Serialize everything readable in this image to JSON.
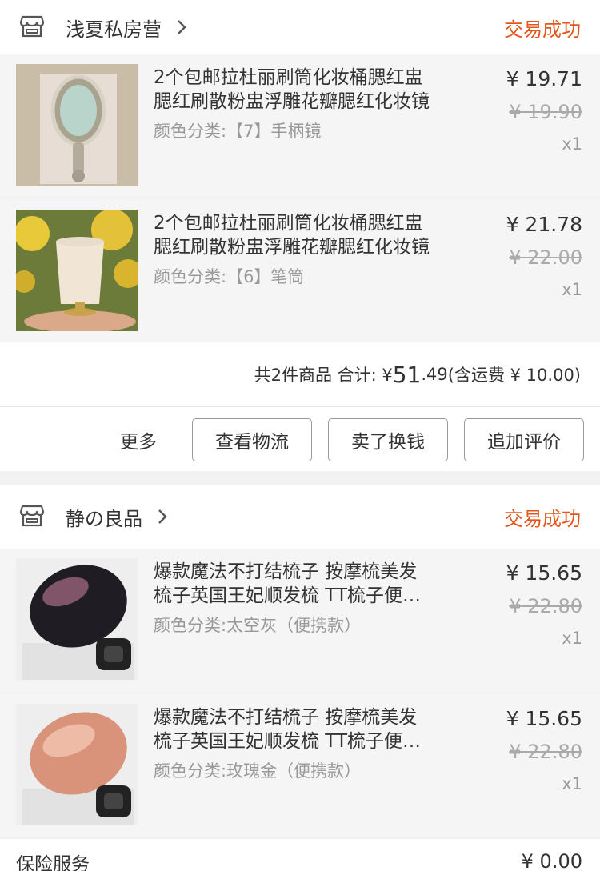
{
  "orders": [
    {
      "shop_name": "浅夏私房营",
      "status": "交易成功",
      "items": [
        {
          "title_line1": "2个包邮拉杜丽刷筒化妆桶腮红盅",
          "title_line2": "腮红刷散粉盅浮雕花瓣腮红化妆镜",
          "spec": "颜色分类:【7】手柄镜",
          "price": "¥ 19.71",
          "original_price": "¥ 19.90",
          "qty": "x1"
        },
        {
          "title_line1": "2个包邮拉杜丽刷筒化妆桶腮红盅",
          "title_line2": "腮红刷散粉盅浮雕花瓣腮红化妆镜",
          "spec": "颜色分类:【6】笔筒",
          "price": "¥ 21.78",
          "original_price": "¥ 22.00",
          "qty": "x1"
        }
      ],
      "summary": {
        "count_text": "共2件商品 合计: ¥ ",
        "total_major": "51",
        "total_minor": ".49",
        "shipping": " (含运费 ¥ 10.00)"
      },
      "actions": {
        "more": "更多",
        "logistics": "查看物流",
        "resell": "卖了换钱",
        "review": "追加评价"
      }
    },
    {
      "shop_name": "静の良品",
      "status": "交易成功",
      "items": [
        {
          "title_line1": "爆款魔法不打结梳子 按摩梳美发",
          "title_line2": "梳子英国王妃顺发梳 TT梳子便…",
          "spec": "颜色分类:太空灰（便携款）",
          "price": "¥ 15.65",
          "original_price": "¥ 22.80",
          "qty": "x1"
        },
        {
          "title_line1": "爆款魔法不打结梳子 按摩梳美发",
          "title_line2": "梳子英国王妃顺发梳 TT梳子便…",
          "spec": "颜色分类:玫瑰金（便携款）",
          "price": "¥ 15.65",
          "original_price": "¥ 22.80",
          "qty": "x1"
        }
      ]
    }
  ],
  "insurance": {
    "label": "保险服务",
    "price": "¥ 0.00"
  },
  "colors": {
    "status": "#e5551b",
    "background": "#f2f2f2",
    "item_bg": "#f5f5f5"
  }
}
